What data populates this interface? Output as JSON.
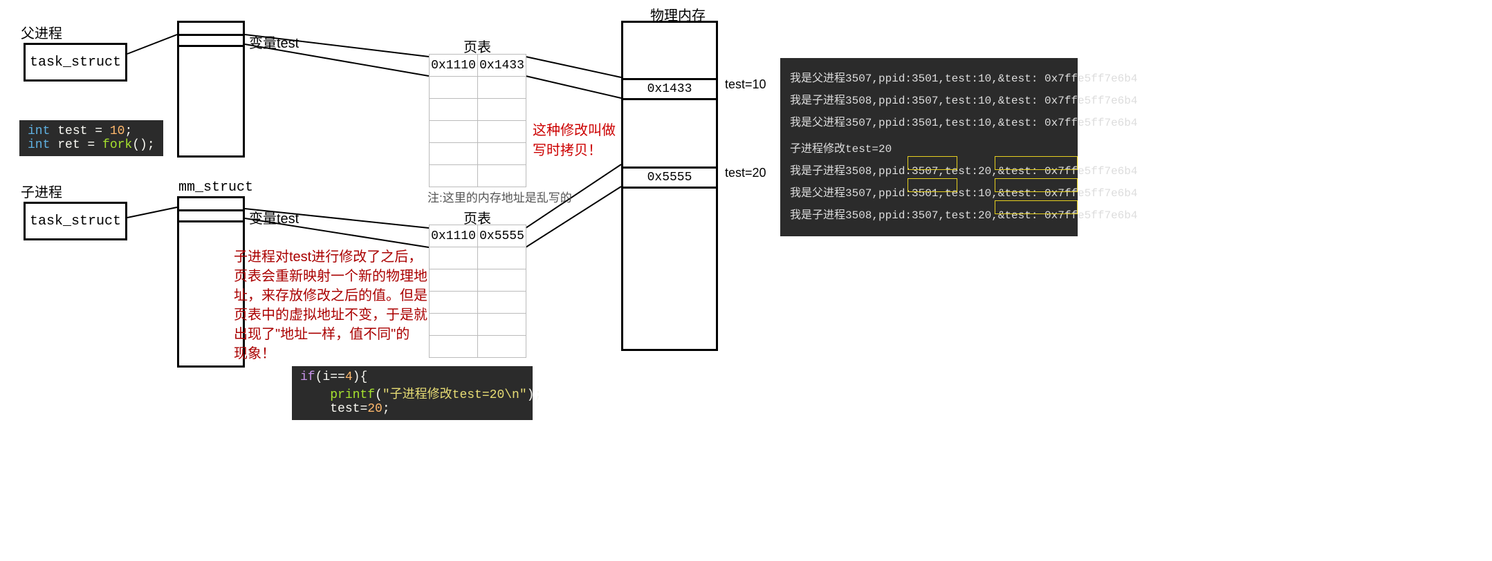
{
  "labels": {
    "parent_process": "父进程",
    "child_process": "子进程",
    "mm_struct": "mm_struct",
    "var_test": "变量test",
    "page_table": "页表",
    "physical_memory": "物理内存",
    "task_struct": "task_struct",
    "note_random_addr": "注:这里的内存地址是乱写的",
    "cow_note_l1": "这种修改叫做",
    "cow_note_l2": "写时拷贝！",
    "explain_l1": "子进程对test进行修改了之后，",
    "explain_l2": "页表会重新映射一个新的物理地",
    "explain_l3": "址，来存放修改之后的值。但是",
    "explain_l4": "页表中的虚拟地址不变，于是就",
    "explain_l5": "出现了\"地址一样，值不同\"的",
    "explain_l6": "现象！",
    "phys_label_1": "test=10",
    "phys_label_2": "test=20"
  },
  "page_tables": {
    "parent": {
      "virt": "0x1110",
      "phys": "0x1433"
    },
    "child": {
      "virt": "0x1110",
      "phys": "0x5555"
    }
  },
  "physical_memory": {
    "entry1": "0x1433",
    "entry2": "0x5555"
  },
  "code_parent": {
    "kw_int1": "int",
    "id_test": "test",
    "eq": " = ",
    "val10": "10",
    "semi": ";",
    "kw_int2": "int",
    "id_ret": "ret",
    "fn_fork": "fork",
    "parens": "();"
  },
  "code_child": {
    "kw_if": "if",
    "cond_open": "(",
    "id_i": "i",
    "eqeq": "==",
    "val4": "4",
    "cond_close": "){",
    "fn_printf": "printf",
    "str_arg": "\"子进程修改test=20\\n\"",
    "close_paren": ");",
    "id_test": "test",
    "eq": "=",
    "val20": "20",
    "semi": ";"
  },
  "terminal": {
    "lines": [
      "我是父进程3507,ppid:3501,test:10,&test: 0x7ffe5ff7e6b4",
      "我是子进程3508,ppid:3507,test:10,&test: 0x7ffe5ff7e6b4",
      "我是父进程3507,ppid:3501,test:10,&test: 0x7ffe5ff7e6b4",
      "子进程修改test=20",
      "我是子进程3508,ppid:3507,test:20,&test: 0x7ffe5ff7e6b4",
      "我是父进程3507,ppid:3501,test:10,&test: 0x7ffe5ff7e6b4",
      "我是子进程3508,ppid:3507,test:20,&test: 0x7ffe5ff7e6b4"
    ]
  }
}
